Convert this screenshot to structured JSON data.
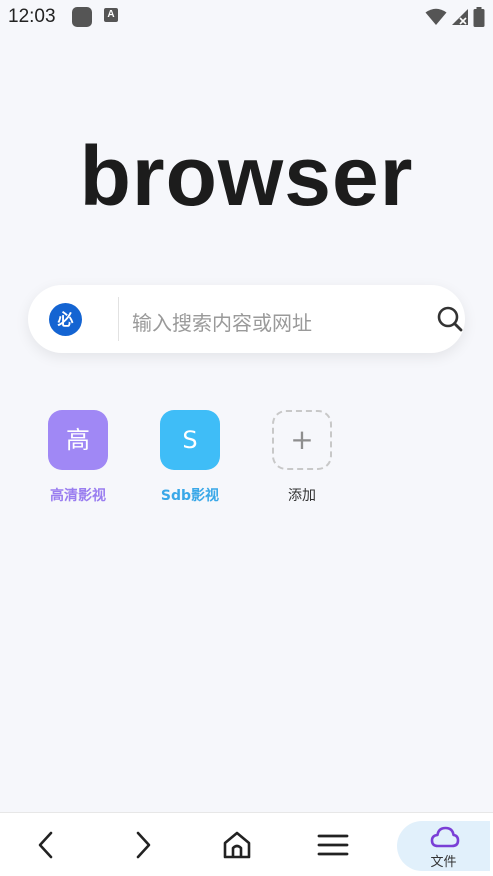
{
  "status_bar": {
    "time": "12:03",
    "a_icon": "A"
  },
  "logo": "browser",
  "search": {
    "engine_icon_text": "必",
    "placeholder": "输入搜索内容或网址"
  },
  "shortcuts": [
    {
      "tile_text": "高",
      "label": "高清影视",
      "color": "#a088f5",
      "label_color": "#9a7ef0"
    },
    {
      "tile_text": "S",
      "label": "Sdb影视",
      "color": "#3fbdf7",
      "label_color": "#3aa8e8"
    },
    {
      "tile_text": "+",
      "label": "添加"
    }
  ],
  "bottom_nav": {
    "back_icon": "chevron-left-icon",
    "forward_icon": "chevron-right-icon",
    "home_icon": "home-icon",
    "menu_icon": "menu-icon",
    "files_label": "文件"
  },
  "colors": {
    "accent": "#1464d2",
    "files_bg": "#e1f0fb",
    "cloud": "#7a3fd6"
  }
}
